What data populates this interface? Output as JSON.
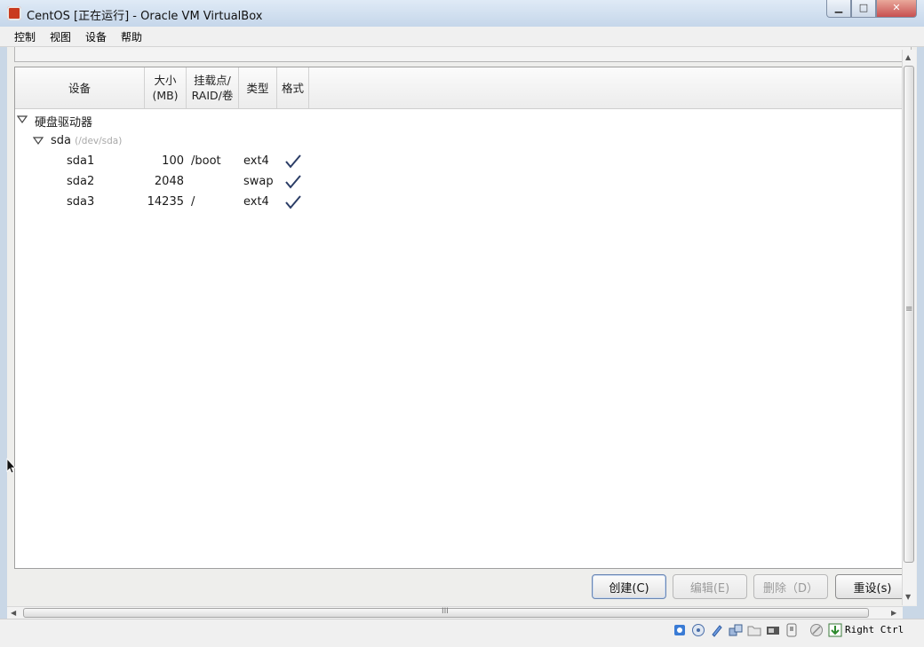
{
  "window": {
    "title": "CentOS [正在运行] - Oracle VM VirtualBox",
    "controls": {
      "minimize": "▁",
      "maximize": "□",
      "close": "✕"
    }
  },
  "menu": [
    "控制",
    "视图",
    "设备",
    "帮助"
  ],
  "table": {
    "headers": {
      "device": "设备",
      "size_line1": "大小",
      "size_line2": "(MB)",
      "mount_line1": "挂载点/",
      "mount_line2": "RAID/卷",
      "type": "类型",
      "format": "格式"
    },
    "group": {
      "label": "硬盘驱动器",
      "expanded": true
    },
    "disk": {
      "name": "sda",
      "path": "(/dev/sda)",
      "expanded": true
    },
    "partitions": [
      {
        "device": "sda1",
        "size": "100",
        "mount": "/boot",
        "type": "ext4",
        "format": true
      },
      {
        "device": "sda2",
        "size": "2048",
        "mount": "",
        "type": "swap",
        "format": true
      },
      {
        "device": "sda3",
        "size": "14235",
        "mount": "/",
        "type": "ext4",
        "format": true
      }
    ]
  },
  "buttons": {
    "create": "创建(C)",
    "edit": "编辑(E)",
    "delete": "删除（D）",
    "reset": "重设(s)"
  },
  "scrollbars": {
    "grip": "≡",
    "hgrip": "III"
  },
  "statusbar": {
    "host_key": "Right Ctrl"
  },
  "colors": {
    "accent": "#3a5f9e",
    "check": "#2b3d66",
    "title_gradient_top": "#dfeaf6"
  }
}
